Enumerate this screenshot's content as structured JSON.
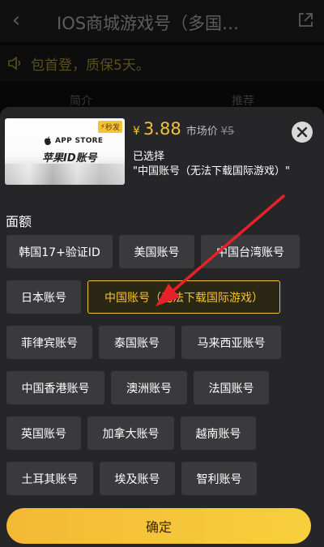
{
  "header": {
    "title": "IOS商城游戏号（多国…",
    "back_icon": "chevron-left-icon",
    "share_icon": "share-icon"
  },
  "notice": {
    "text": "包首登，质保5天。",
    "icon": "speaker-icon"
  },
  "tabs": [
    {
      "label": "简介"
    },
    {
      "label": "推荐"
    }
  ],
  "product": {
    "image_store_text": "APP STORE",
    "image_name": "苹果ID账号",
    "flash_badge": "秒发",
    "currency": "¥",
    "price": "3.88",
    "market_label": "市场价",
    "market_price": "¥5",
    "selected_label": "已选择",
    "selected_value": "\"中国账号（无法下载国际游戏）\""
  },
  "section": {
    "title": "面额"
  },
  "options": [
    {
      "label": "韩国17+验证ID",
      "selected": false
    },
    {
      "label": "美国账号",
      "selected": false
    },
    {
      "label": "中国台湾账号",
      "selected": false
    },
    {
      "label": "日本账号",
      "selected": false
    },
    {
      "label": "中国账号（无法下载国际游戏）",
      "selected": true
    },
    {
      "label": "菲律宾账号",
      "selected": false
    },
    {
      "label": "泰国账号",
      "selected": false
    },
    {
      "label": "马来西亚账号",
      "selected": false
    },
    {
      "label": "中国香港账号",
      "selected": false
    },
    {
      "label": "澳洲账号",
      "selected": false
    },
    {
      "label": "法国账号",
      "selected": false
    },
    {
      "label": "英国账号",
      "selected": false
    },
    {
      "label": "加拿大账号",
      "selected": false
    },
    {
      "label": "越南账号",
      "selected": false
    },
    {
      "label": "土耳其账号",
      "selected": false
    },
    {
      "label": "埃及账号",
      "selected": false
    },
    {
      "label": "智利账号",
      "selected": false
    }
  ],
  "confirm": {
    "label": "确定"
  },
  "colors": {
    "accent": "#f4c235",
    "sheet": "#262628",
    "option_bg": "#3a3a3c",
    "annotation_arrow": "#e8202a"
  }
}
